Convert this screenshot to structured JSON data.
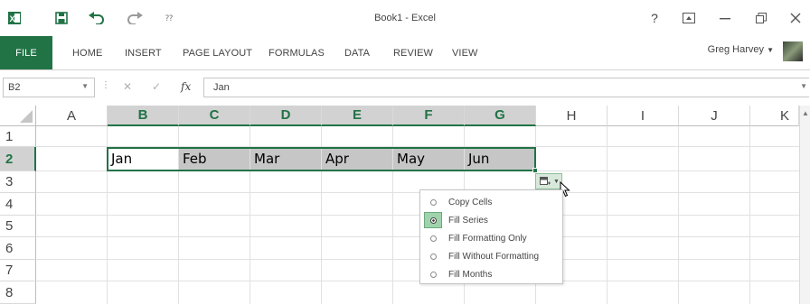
{
  "titlebar": {
    "title": "Book1 - Excel",
    "help": "?",
    "icons": [
      "excel-icon",
      "save-icon",
      "undo-icon",
      "redo-icon",
      "customize-qat-icon"
    ]
  },
  "ribbon": {
    "tabs": [
      "FILE",
      "HOME",
      "INSERT",
      "PAGE LAYOUT",
      "FORMULAS",
      "DATA",
      "REVIEW",
      "VIEW"
    ],
    "user": "Greg Harvey",
    "accent": "#217346"
  },
  "formula_bar": {
    "name_box": "B2",
    "fx": "fx",
    "value": "Jan"
  },
  "grid": {
    "columns": [
      "A",
      "B",
      "C",
      "D",
      "E",
      "F",
      "G",
      "H",
      "I",
      "J",
      "K"
    ],
    "rows": [
      "1",
      "2",
      "3",
      "4",
      "5",
      "6",
      "7",
      "8"
    ],
    "row2": [
      "",
      "Jan",
      "Feb",
      "Mar",
      "Apr",
      "May",
      "Jun",
      "",
      "",
      "",
      ""
    ]
  },
  "autofill_menu": {
    "items": [
      {
        "label": "Copy Cells",
        "checked": false
      },
      {
        "label": "Fill Series",
        "checked": true
      },
      {
        "label": "Fill Formatting Only",
        "checked": false
      },
      {
        "label": "Fill Without Formatting",
        "checked": false
      },
      {
        "label": "Fill Months",
        "checked": false
      }
    ]
  }
}
